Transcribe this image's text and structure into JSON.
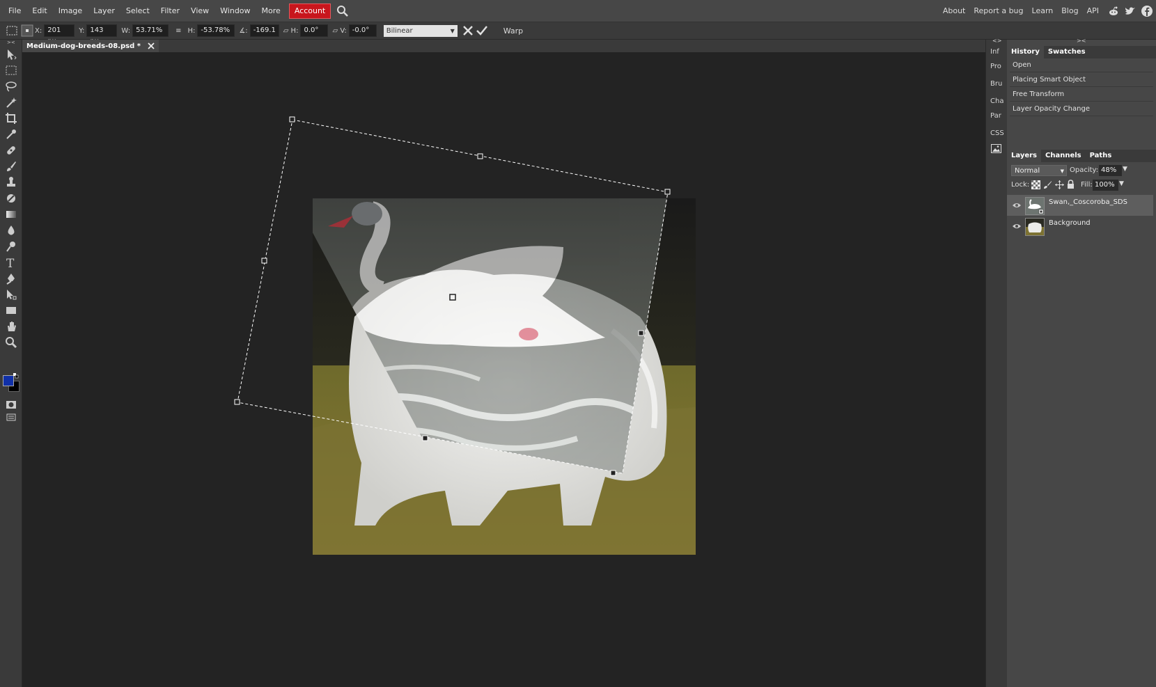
{
  "menu": {
    "items": [
      "File",
      "Edit",
      "Image",
      "Layer",
      "Select",
      "Filter",
      "View",
      "Window",
      "More"
    ],
    "account": "Account",
    "right_links": [
      "About",
      "Report a bug",
      "Learn",
      "Blog",
      "API"
    ]
  },
  "options": {
    "x_label": "X:",
    "x_value": "201 px",
    "y_label": "Y:",
    "y_value": "143 px",
    "w_label": "W:",
    "w_value": "53.71%",
    "link_symbol": "≡",
    "h_label": "H:",
    "h_value": "-53.78%",
    "angle_label": "∡:",
    "angle_value": "-169.1",
    "hskew_label": "▱ H:",
    "hskew_value": "0.0°",
    "vskew_label": "▱ V:",
    "vskew_value": "-0.0°",
    "interpolation": "Bilinear",
    "warp": "Warp"
  },
  "document": {
    "tab_title": "Medium-dog-breeds-08.psd *"
  },
  "collapsed_panel": [
    "Inf",
    "Pro",
    "Bru",
    "Cha",
    "Par",
    "CSS"
  ],
  "history": {
    "tabs": [
      "History",
      "Swatches"
    ],
    "items": [
      "Open",
      "Placing Smart Object",
      "Free Transform",
      "Layer Opacity Change"
    ]
  },
  "layers": {
    "tabs": [
      "Layers",
      "Channels",
      "Paths"
    ],
    "blend_mode": "Normal",
    "opacity_label": "Opacity:",
    "opacity_value": "48%",
    "lock_label": "Lock:",
    "fill_label": "Fill:",
    "fill_value": "100%",
    "rows": [
      {
        "name": "Swan,_Coscoroba_SDS",
        "selected": true
      },
      {
        "name": "Background",
        "selected": false
      }
    ]
  },
  "colors": {
    "foreground": "#1030a8",
    "background": "#000000",
    "account_red": "#c8161d"
  }
}
